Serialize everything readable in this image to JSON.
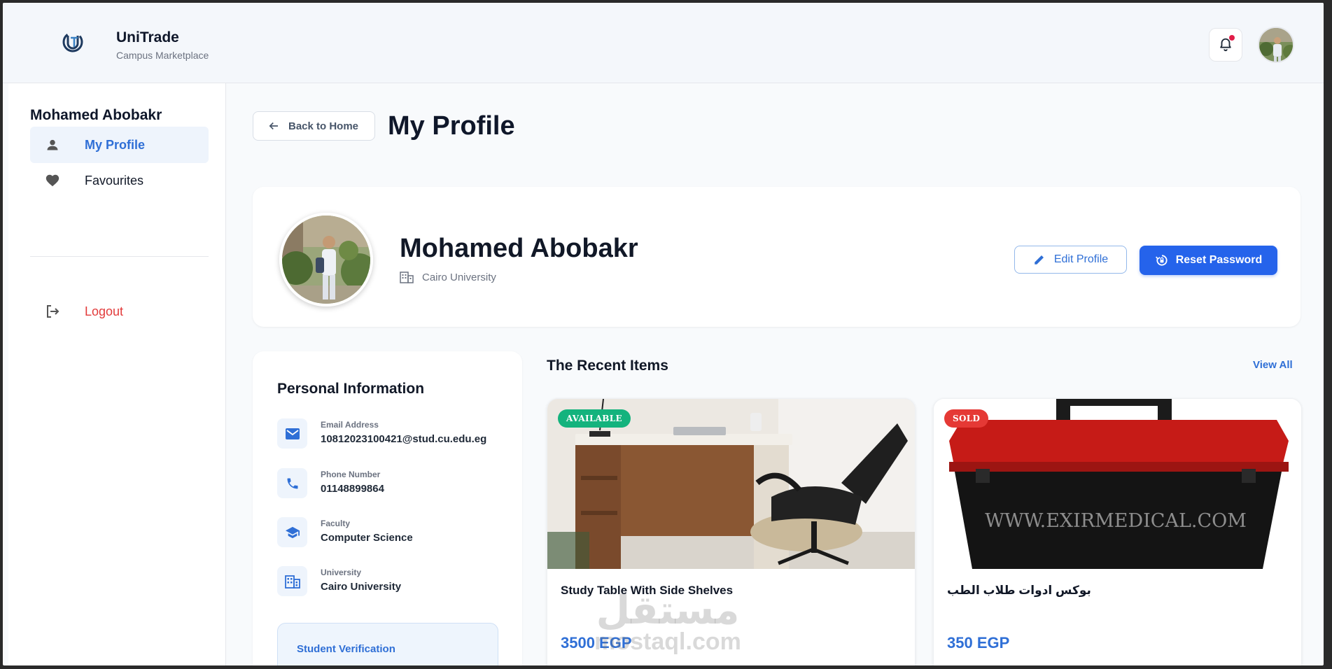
{
  "header": {
    "brand_title": "UniTrade",
    "brand_subtitle": "Campus Marketplace"
  },
  "sidebar": {
    "user_name": "Mohamed Abobakr",
    "items": [
      {
        "label": "My Profile",
        "icon": "person-icon",
        "active": true
      },
      {
        "label": "Favourites",
        "icon": "heart-icon",
        "active": false
      }
    ],
    "logout_label": "Logout"
  },
  "main": {
    "back_label": "Back to Home",
    "page_title": "My Profile",
    "profile": {
      "name": "Mohamed Abobakr",
      "university": "Cairo University",
      "edit_label": "Edit Profile",
      "reset_label": "Reset Password"
    },
    "personal_info": {
      "title": "Personal Information",
      "rows": [
        {
          "label": "Email Address",
          "value": "10812023100421@stud.cu.edu.eg",
          "icon": "email-icon"
        },
        {
          "label": "Phone Number",
          "value": "01148899864",
          "icon": "phone-icon"
        },
        {
          "label": "Faculty",
          "value": "Computer Science",
          "icon": "school-icon"
        },
        {
          "label": "University",
          "value": "Cairo University",
          "icon": "building-icon"
        }
      ],
      "verification_title": "Student Verification"
    },
    "recent": {
      "title": "The Recent Items",
      "view_all": "View All",
      "items": [
        {
          "badge": "AVAILABLE",
          "title": "Study Table With Side Shelves",
          "price": "3500 EGP"
        },
        {
          "badge": "SOLD",
          "title": "بوكس ادوات طلاب الطب",
          "price": "350 EGP",
          "image_text": "WWW.EXIRMEDICAL.COM"
        }
      ]
    }
  },
  "watermark": {
    "arabic": "مستقل",
    "latin": "mostaql.com"
  },
  "colors": {
    "accent": "#2f6fd6",
    "primary_button": "#2563eb",
    "available": "#14b37d",
    "sold": "#e53935",
    "logout": "#e23b3b"
  }
}
